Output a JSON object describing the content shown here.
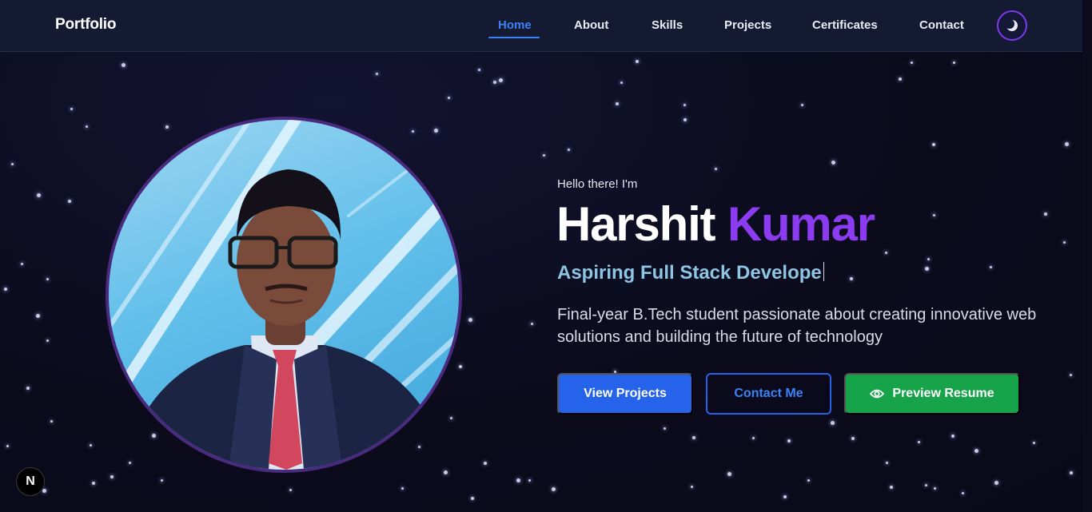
{
  "navbar": {
    "brand": "Portfolio",
    "links": [
      {
        "label": "Home",
        "active": true
      },
      {
        "label": "About"
      },
      {
        "label": "Skills"
      },
      {
        "label": "Projects"
      },
      {
        "label": "Certificates"
      },
      {
        "label": "Contact"
      }
    ],
    "theme_toggle_icon": "moon-icon"
  },
  "hero": {
    "greeting": "Hello there! I'm",
    "first_name": "Harshit",
    "last_name": "Kumar",
    "tagline": "Aspiring Full Stack Develope",
    "description": "Final-year B.Tech student passionate about creating innovative web solutions and building the future of technology",
    "buttons": {
      "view_projects": "View Projects",
      "contact_me": "Contact Me",
      "preview_resume": "Preview Resume"
    },
    "portrait_icon": "profile-photo"
  },
  "dev_badge": {
    "label": "N"
  },
  "colors": {
    "background": "#0b0b1c",
    "navbar": "#151a33",
    "accent_blue": "#2563eb",
    "accent_purple": "#8b3cf0",
    "tagline": "#8ec5e3",
    "resume_green": "#16a34a"
  }
}
